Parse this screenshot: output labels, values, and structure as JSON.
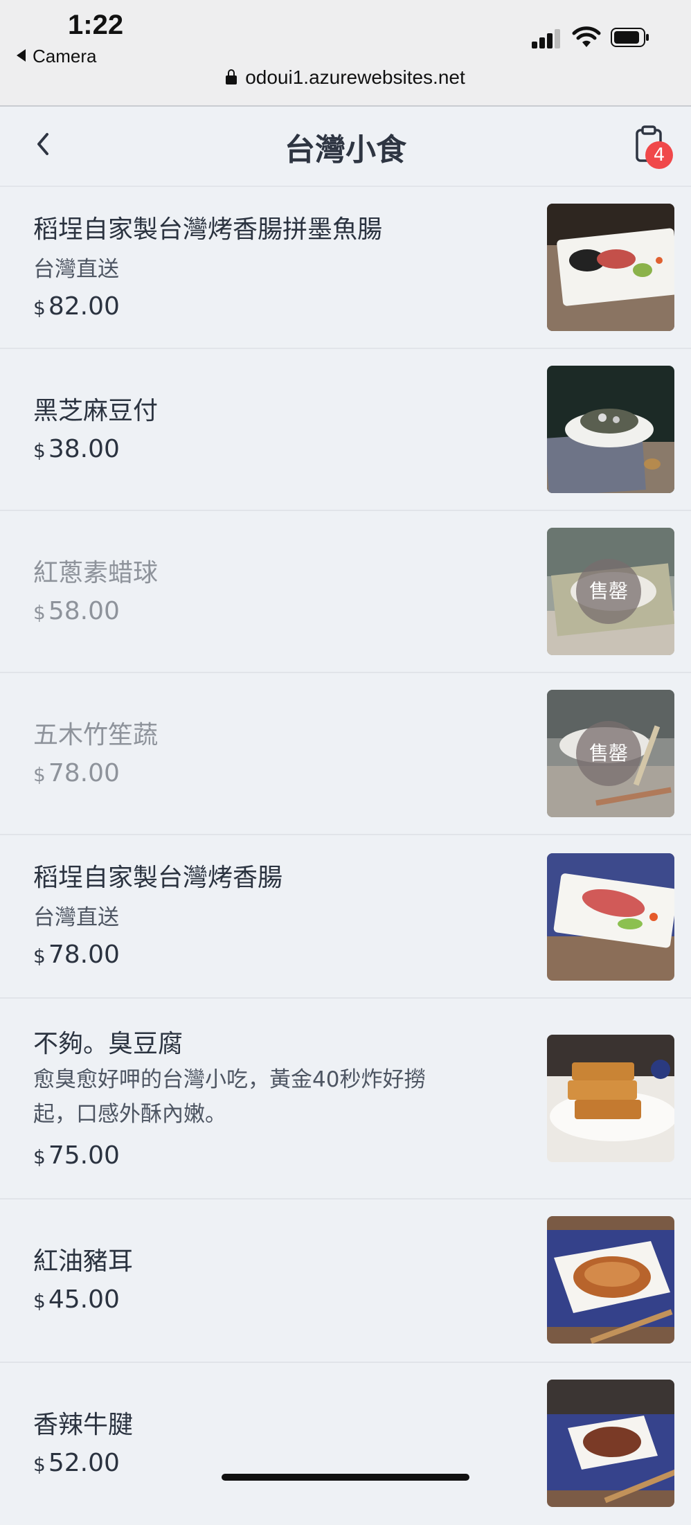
{
  "status": {
    "time": "1:22",
    "back_app": "Camera",
    "url": "odoui1.azurewebsites.net"
  },
  "header": {
    "title": "台灣小食",
    "cart_count": "4"
  },
  "currency": "$",
  "items": [
    {
      "name": "稻埕自家製台灣烤香腸拼墨魚腸",
      "desc": "台灣直送",
      "price": "82.00",
      "sold_out": ""
    },
    {
      "name": "黑芝麻豆付",
      "desc": "",
      "price": "38.00",
      "sold_out": ""
    },
    {
      "name": "紅蔥素蜡球",
      "desc": "",
      "price": "58.00",
      "sold_out": "售罄"
    },
    {
      "name": "五木竹笙蔬",
      "desc": "",
      "price": "78.00",
      "sold_out": "售罄"
    },
    {
      "name": "稻埕自家製台灣烤香腸",
      "desc": "台灣直送",
      "price": "78.00",
      "sold_out": ""
    },
    {
      "name": "不夠。臭豆腐",
      "desc_lines": [
        "愈臭愈好呷的台灣小吃，黃金40秒炸好撈",
        "起，口感外酥內嫩。"
      ],
      "price": "75.00",
      "sold_out": ""
    },
    {
      "name": "紅油豬耳",
      "desc": "",
      "price": "45.00",
      "sold_out": ""
    },
    {
      "name": "香辣牛腱",
      "desc": "",
      "price": "52.00",
      "sold_out": ""
    }
  ]
}
